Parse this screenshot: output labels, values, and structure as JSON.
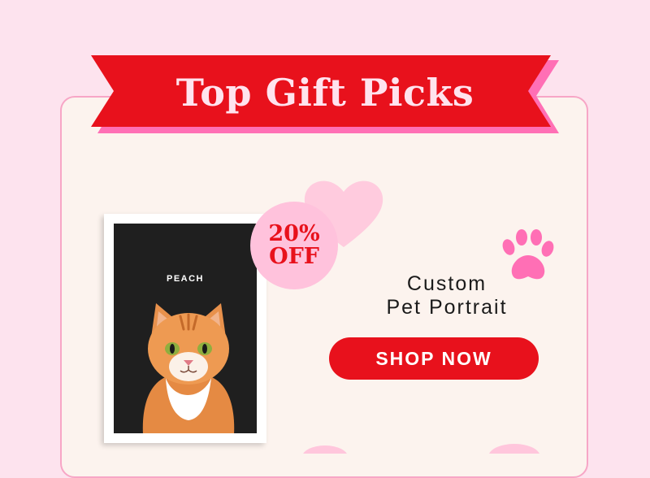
{
  "banner": {
    "title": "Top Gift Picks"
  },
  "product": {
    "pet_name": "PEACH",
    "title_line1": "Custom",
    "title_line2": "Pet Portrait",
    "discount_line1": "20%",
    "discount_line2": "OFF"
  },
  "cta": {
    "label": "SHOP NOW"
  },
  "icons": {
    "heart": "heart-icon",
    "paw": "paw-print-icon"
  },
  "colors": {
    "background": "#fde3ee",
    "card": "#fcf3ee",
    "accent_red": "#e8111c",
    "accent_pink": "#ff6fb5",
    "badge_pink": "#ffc2dc"
  }
}
